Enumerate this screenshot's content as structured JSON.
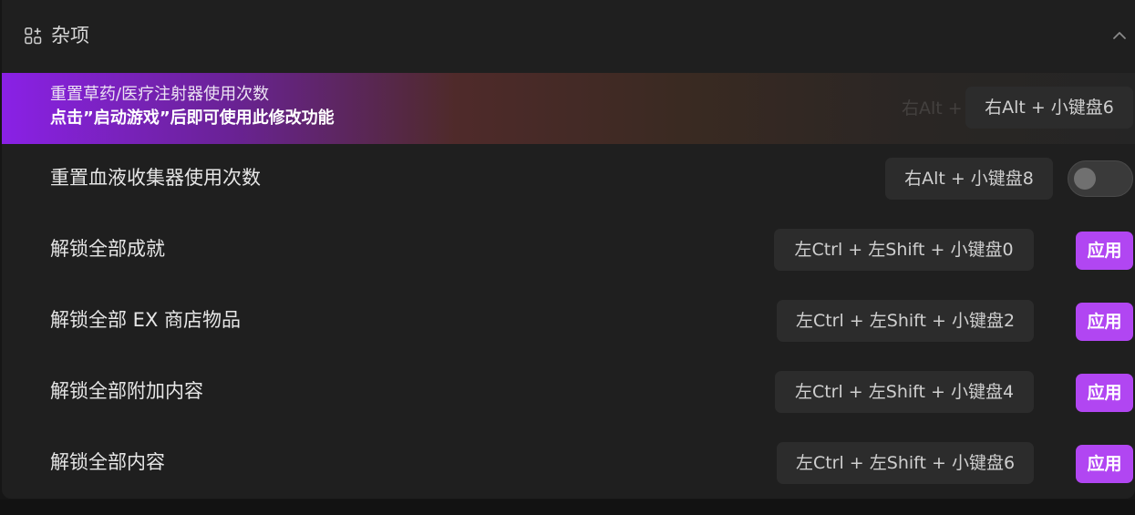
{
  "section": {
    "title": "杂项"
  },
  "rows": [
    {
      "title": "重置草药/医疗注射器使用次数",
      "subtitle": "点击”启动游戏”后即可使用此修改功能",
      "ghost_hotkey": "右Alt + 小",
      "hotkey": "右Alt + 小键盘6"
    },
    {
      "title": "重置血液收集器使用次数",
      "hotkey": "右Alt + 小键盘8",
      "toggle_on": false
    },
    {
      "title": "解锁全部成就",
      "hotkey": "左Ctrl + 左Shift + 小键盘0",
      "action": "应用"
    },
    {
      "title": "解锁全部 EX 商店物品",
      "hotkey": "左Ctrl + 左Shift + 小键盘2",
      "action": "应用"
    },
    {
      "title": "解锁全部附加内容",
      "hotkey": "左Ctrl + 左Shift + 小键盘4",
      "action": "应用"
    },
    {
      "title": "解锁全部内容",
      "hotkey": "左Ctrl + 左Shift + 小键盘6",
      "action": "应用"
    }
  ],
  "icons": {
    "section": "apps-plus-icon",
    "collapse": "chevron-up-icon"
  },
  "colors": {
    "accent": "#b146f2",
    "highlight_start": "#8a21e6",
    "panel_bg": "#1f1f1f",
    "hotkey_bg": "#2c2c2c"
  }
}
